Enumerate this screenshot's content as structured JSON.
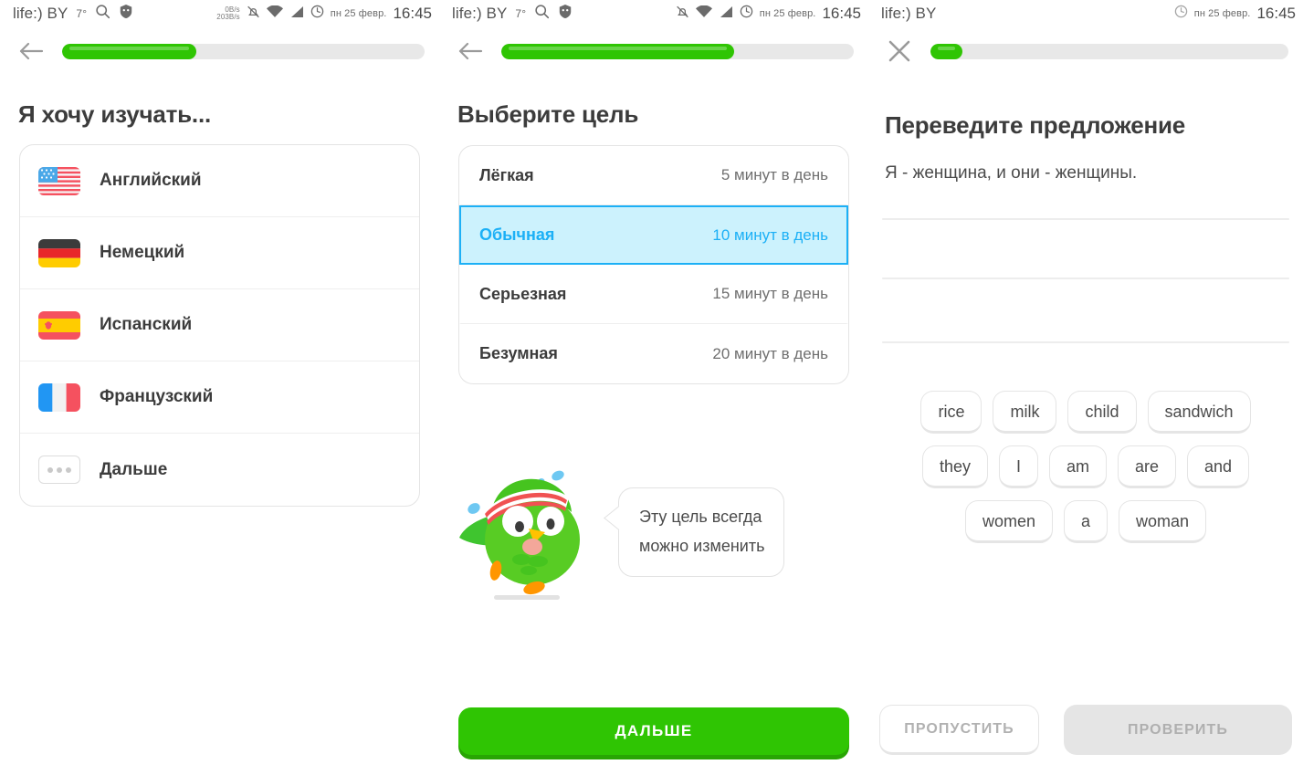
{
  "statusbar": {
    "carrier": "life:) BY",
    "temperature": "7°",
    "network_up": "0B/s",
    "network_down": "203B/s",
    "date": "пн 25 февр.",
    "time": "16:45",
    "icons": [
      "search-icon",
      "shield-icon",
      "bell-off-icon",
      "wifi-icon",
      "signal-icon",
      "alarm-icon"
    ]
  },
  "panel1": {
    "nav_icon": "back-arrow-icon",
    "progress_percent": 37,
    "heading": "Я хочу изучать...",
    "languages": [
      {
        "label": "Английский",
        "flag": "flag-us-icon"
      },
      {
        "label": "Немецкий",
        "flag": "flag-de-icon"
      },
      {
        "label": "Испанский",
        "flag": "flag-es-icon"
      },
      {
        "label": "Французский",
        "flag": "flag-fr-icon"
      },
      {
        "label": "Дальше",
        "flag": "more-dots-icon"
      }
    ]
  },
  "panel2": {
    "nav_icon": "back-arrow-icon",
    "progress_percent": 66,
    "heading": "Выберите цель",
    "goals": [
      {
        "name": "Лёгкая",
        "time": "5 минут в день",
        "selected": false
      },
      {
        "name": "Обычная",
        "time": "10 минут в день",
        "selected": true
      },
      {
        "name": "Серьезная",
        "time": "15 минут в день",
        "selected": false
      },
      {
        "name": "Безумная",
        "time": "20 минут в день",
        "selected": false
      }
    ],
    "mascot": "duolingo-owl-icon",
    "bubble_line1": "Эту цель всегда",
    "bubble_line2": "можно изменить",
    "next_button": "ДАЛЬШЕ"
  },
  "panel3": {
    "nav_icon": "close-x-icon",
    "progress_percent": 9,
    "heading": "Переведите предложение",
    "sentence": "Я - женщина, и они - женщины.",
    "answer_lines": 3,
    "wordbank": [
      [
        "rice",
        "milk",
        "child",
        "sandwich"
      ],
      [
        "they",
        "I",
        "am",
        "are",
        "and"
      ],
      [
        "women",
        "a",
        "woman"
      ]
    ],
    "skip_button": "ПРОПУСТИТЬ",
    "check_button": "ПРОВЕРИТЬ"
  },
  "colors": {
    "green": "#2fc503",
    "green_shadow": "#28a504",
    "blue_accent": "#1cb0f6",
    "blue_fill": "#ccf2fd",
    "track": "#e8e8e8",
    "text": "#3c3c3c"
  }
}
